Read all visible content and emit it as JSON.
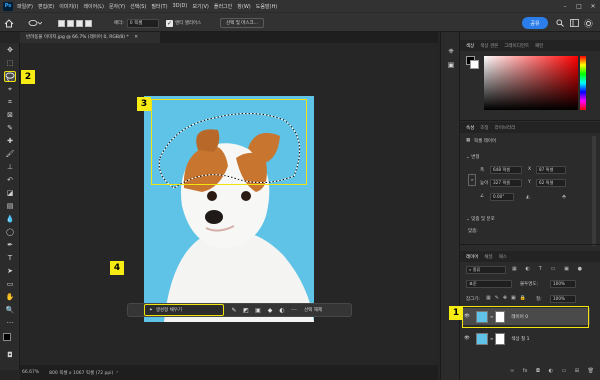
{
  "menu": [
    "파일(F)",
    "편집(E)",
    "이미지(I)",
    "레이어(L)",
    "문자(Y)",
    "선택(S)",
    "필터(T)",
    "3D(D)",
    "보기(V)",
    "플러그인",
    "창(W)",
    "도움말(H)"
  ],
  "options": {
    "feather_label": "페더:",
    "feather_value": "0 픽셀",
    "antialias_label": "앤티 앨리어스",
    "select_mask_button": "선택 및 마스크...",
    "share_button": "공유"
  },
  "document": {
    "tab_title": "반려동물 이미지.jpg @ 66.7% (레이어 0, RGB/8) *",
    "zoom": "66.67%",
    "status": "800 픽셀 x 1067 픽셀 (72 ppi)"
  },
  "context_bar": {
    "generative_fill": "생성형 채우기",
    "deselect": "선택 해제"
  },
  "callouts": [
    "1",
    "2",
    "3",
    "4"
  ],
  "color_panel": {
    "tabs": [
      "색상",
      "색상 견본",
      "그레이디언트",
      "패턴"
    ],
    "fg_color": "#000000",
    "bg_color": "#ffffff"
  },
  "properties_panel": {
    "tabs": [
      "속성",
      "조정",
      "라이브러리"
    ],
    "layer_type": "픽셀 레이어",
    "transform_header": "변형",
    "w_label": "폭",
    "w_value": "648 픽셀",
    "x_label": "X",
    "x_value": "87 픽셀",
    "h_label": "높이",
    "h_value": "327 픽셀",
    "y_label": "Y",
    "y_value": "62 픽셀",
    "angle_value": "0.00°",
    "align_header": "맞춤 및 분포",
    "align_label": "맞춤:"
  },
  "layers_panel": {
    "tabs": [
      "레이어",
      "채널",
      "패스"
    ],
    "filter_label": "종류",
    "blend_mode": "표준",
    "opacity_label": "불투명도:",
    "opacity_value": "100%",
    "lock_label": "잠그기:",
    "fill_label": "칠:",
    "fill_value": "100%",
    "layers": [
      {
        "name": "레이어 0",
        "selected": true
      },
      {
        "name": "색상 칠 1",
        "selected": false
      }
    ]
  },
  "colors": {
    "accent": "#f1e30c",
    "share": "#2b7de9",
    "sky": "#5ec3e6"
  }
}
